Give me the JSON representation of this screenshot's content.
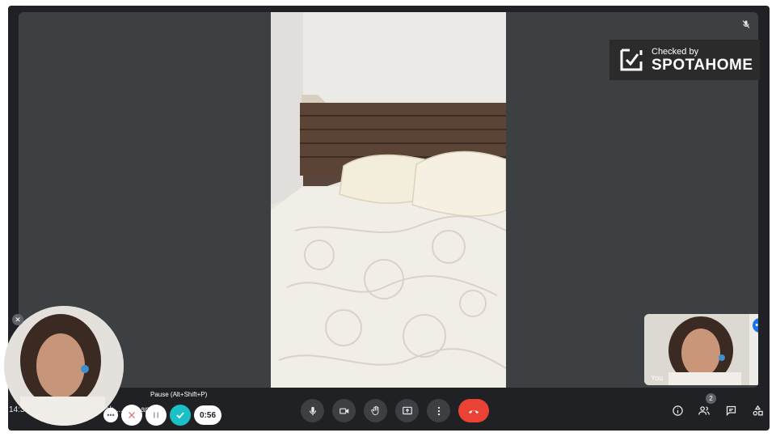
{
  "meeting": {
    "clock": "14:3",
    "title_fragment": "ah ... fl ... ap ..."
  },
  "badge": {
    "line1": "Checked by",
    "line2": "SPOTAHOME"
  },
  "self_view": {
    "label": "You"
  },
  "participants": {
    "count": "2"
  },
  "recorder": {
    "tooltip": "Pause (Alt+Shift+P)",
    "time": "0:56"
  },
  "icons": {
    "mic": "mic-icon",
    "camera": "camera-icon",
    "hand": "raise-hand-icon",
    "present": "present-icon",
    "more": "more-vert-icon",
    "hangup": "hangup-icon",
    "info": "info-icon",
    "people": "people-icon",
    "chat": "chat-icon",
    "activities": "activities-icon",
    "muted": "mic-off-icon"
  },
  "colors": {
    "hangup": "#ea4335",
    "accent": "#1a73e8",
    "record_done": "#1ac0c6"
  }
}
